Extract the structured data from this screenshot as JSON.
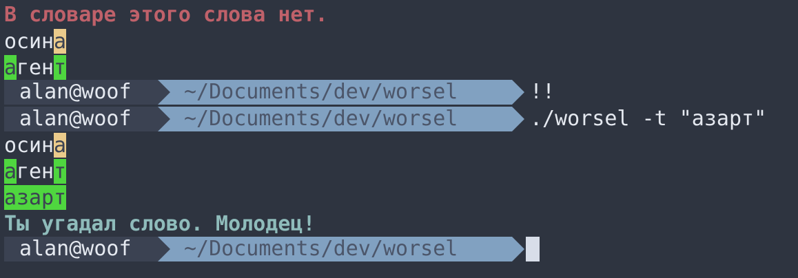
{
  "terminal": {
    "messages": {
      "not_in_dict": "В словаре этого слова нет.",
      "won": "Ты угадал слово. Молодец!"
    },
    "prompt": {
      "user_host": "alan@woof",
      "path": "~/Documents/dev/worsel"
    },
    "commands": [
      "!!",
      "./worsel -t \"азарт\""
    ],
    "guesses_first_run": [
      {
        "letters": [
          "о",
          "с",
          "и",
          "н",
          "а"
        ],
        "states": [
          "absent",
          "absent",
          "absent",
          "absent",
          "present"
        ]
      },
      {
        "letters": [
          "а",
          "г",
          "е",
          "н",
          "т"
        ],
        "states": [
          "correct",
          "absent",
          "absent",
          "absent",
          "correct"
        ]
      }
    ],
    "guesses_second_run": [
      {
        "letters": [
          "о",
          "с",
          "и",
          "н",
          "а"
        ],
        "states": [
          "absent",
          "absent",
          "absent",
          "absent",
          "present"
        ]
      },
      {
        "letters": [
          "а",
          "г",
          "е",
          "н",
          "т"
        ],
        "states": [
          "correct",
          "absent",
          "absent",
          "absent",
          "correct"
        ]
      },
      {
        "letters": [
          "а",
          "з",
          "а",
          "р",
          "т"
        ],
        "states": [
          "correct",
          "correct",
          "correct",
          "correct",
          "correct"
        ]
      }
    ],
    "colors": {
      "background": "#2e3440",
      "present": "#ebcb8b",
      "correct": "#4fd63f",
      "error": "#bf616a",
      "success": "#8fbcbb",
      "path_segment": "#81a1c1"
    }
  }
}
